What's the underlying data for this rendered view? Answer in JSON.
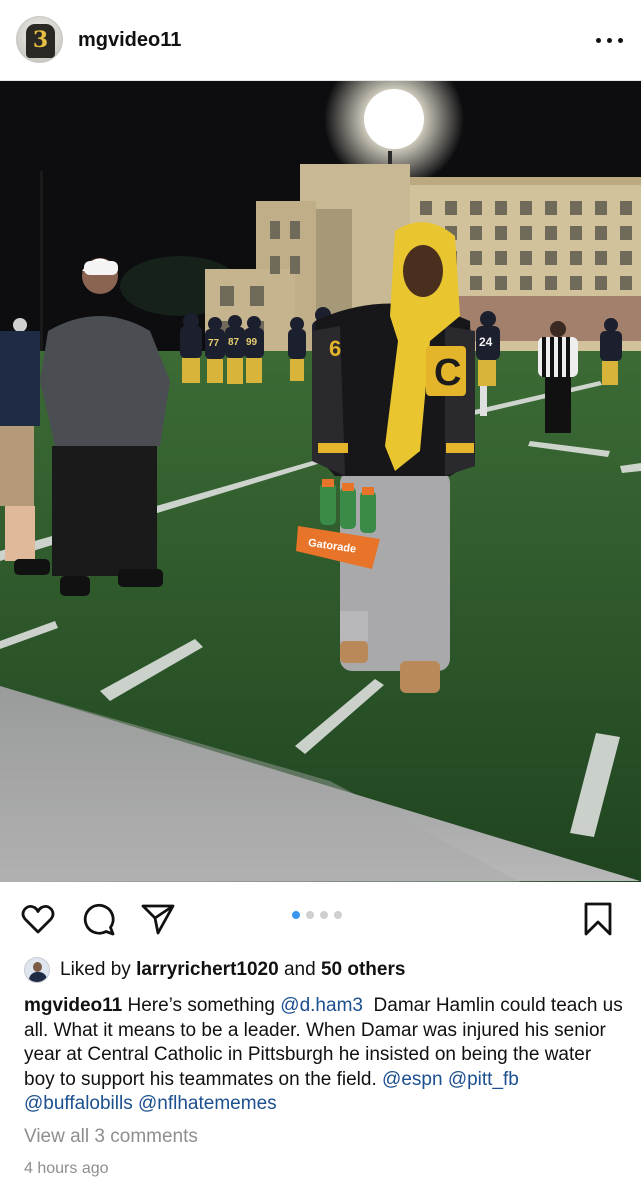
{
  "post": {
    "username": "mgvideo11",
    "avatar_number": "3",
    "more_icon": "more-horizontal-icon"
  },
  "photo": {
    "gatorade_label": "Gatorade",
    "player_jersey_numbers": [
      "77",
      "87",
      "99",
      "24"
    ],
    "jacket_letter": "C",
    "sleeve_number": "6"
  },
  "actions": {
    "icons": [
      "heart-icon",
      "comment-icon",
      "share-icon",
      "bookmark-icon"
    ],
    "carousel_dots": 4,
    "carousel_active_index": 0
  },
  "likes": {
    "prefix": "Liked by",
    "user": "larryrichert1020",
    "and": "and",
    "others": "50 others"
  },
  "caption": {
    "author": "mgvideo11",
    "text_1": "Here’s something",
    "mention_1": "@d.ham3",
    "text_2": "Damar Hamlin could teach us all. What it means to be a leader. When Damar was injured his senior year at Central Catholic in Pittsburgh he insisted on being the water boy to support his teammates on the field.",
    "mentions_end": [
      "@espn",
      "@pitt_fb",
      "@buffalobills",
      "@nflhatememes"
    ]
  },
  "comments": {
    "view_all": "View all 3 comments"
  },
  "timestamp": "4 hours ago",
  "colors": {
    "accent_blue": "#3897f0",
    "mention_blue": "#1b4f8f",
    "muted_gray": "#8e8e8e",
    "turf_green": "#2f5a2a",
    "gatorade_orange": "#e8742a",
    "hoodie_yellow": "#e9c62f"
  }
}
